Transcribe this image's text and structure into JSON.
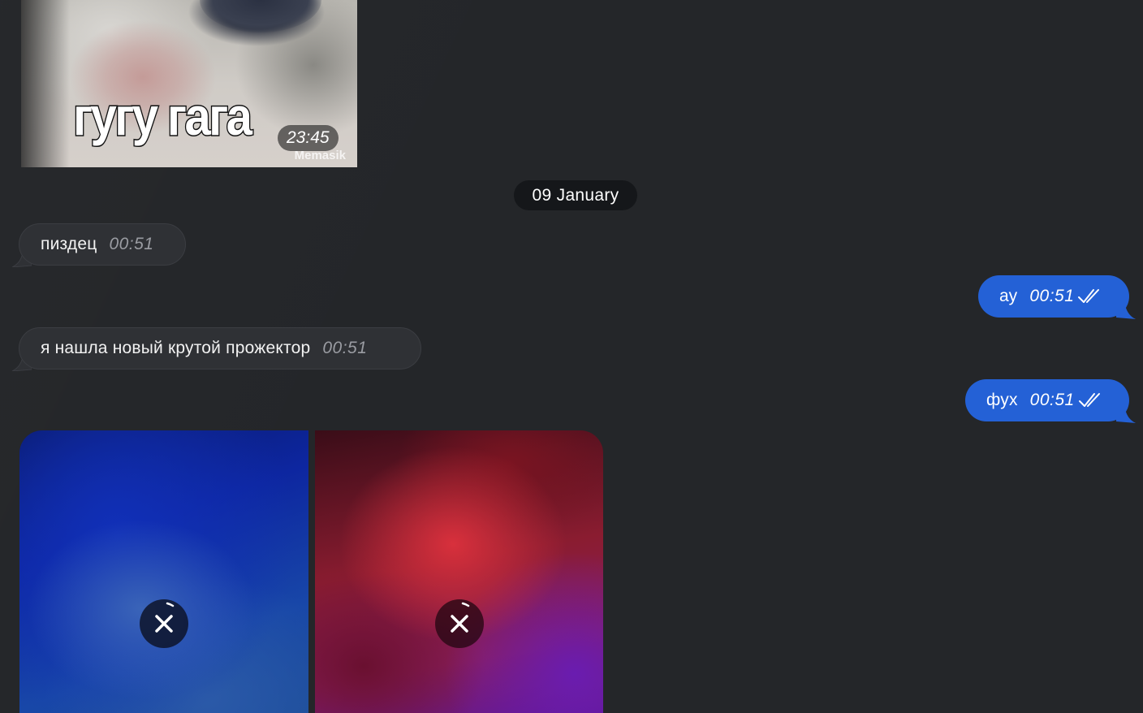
{
  "sticker": {
    "caption": "гугу гага",
    "watermark": "Memasik",
    "time": "23:45"
  },
  "date_separator": "09 January",
  "messages": [
    {
      "direction": "in",
      "text": "пиздец",
      "time": "00:51"
    },
    {
      "direction": "out",
      "text": "ау",
      "time": "00:51",
      "status": "read",
      "status_icon": "double-check-icon"
    },
    {
      "direction": "in",
      "text": "я нашла новый крутой прожектор",
      "time": "00:51"
    },
    {
      "direction": "out",
      "text": "фух",
      "time": "00:51",
      "status": "read",
      "status_icon": "double-check-icon"
    }
  ],
  "media": [
    {
      "kind": "image",
      "state": "uploading",
      "action_icon": "cancel-upload-icon"
    },
    {
      "kind": "image",
      "state": "uploading",
      "action_icon": "cancel-upload-icon"
    }
  ],
  "colors": {
    "background": "#242629",
    "incoming_bubble": "#2f3135",
    "outgoing_bubble": "#2461d6",
    "date_pill": "#15171a"
  }
}
